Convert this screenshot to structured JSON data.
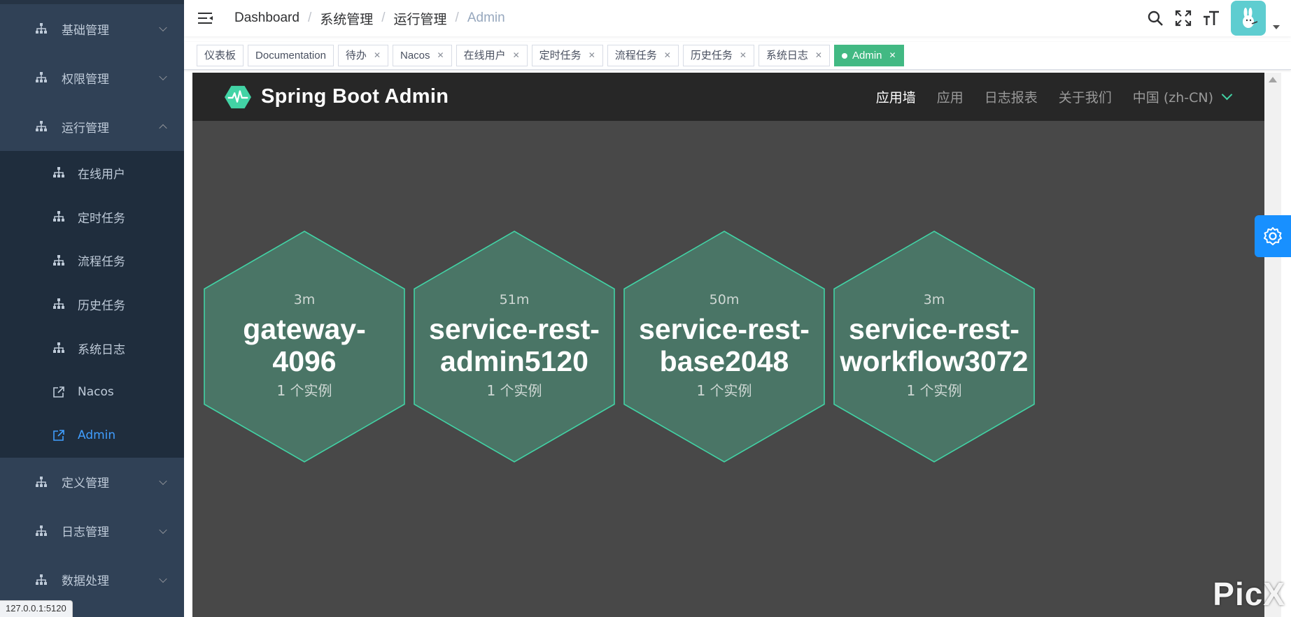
{
  "sidebar": {
    "menus_top": [
      {
        "label": "基础管理",
        "expanded": false
      },
      {
        "label": "权限管理",
        "expanded": false
      },
      {
        "label": "运行管理",
        "expanded": true
      }
    ],
    "submenu": [
      {
        "label": "在线用户",
        "icon": "tree-icon",
        "active": false
      },
      {
        "label": "定时任务",
        "icon": "tree-icon",
        "active": false
      },
      {
        "label": "流程任务",
        "icon": "tree-icon",
        "active": false
      },
      {
        "label": "历史任务",
        "icon": "tree-icon",
        "active": false
      },
      {
        "label": "系统日志",
        "icon": "tree-icon",
        "active": false
      },
      {
        "label": "Nacos",
        "icon": "external-link-icon",
        "active": false
      },
      {
        "label": "Admin",
        "icon": "external-link-icon",
        "active": true
      }
    ],
    "menus_bottom": [
      {
        "label": "定义管理",
        "expanded": false
      },
      {
        "label": "日志管理",
        "expanded": false
      },
      {
        "label": "数据处理",
        "expanded": false
      }
    ]
  },
  "status_url": "127.0.0.1:5120",
  "breadcrumb": [
    "Dashboard",
    "系统管理",
    "运行管理",
    "Admin"
  ],
  "tags": [
    {
      "label": "仪表板",
      "closable": false,
      "active": false
    },
    {
      "label": "Documentation",
      "closable": false,
      "active": false
    },
    {
      "label": "待办",
      "closable": true,
      "active": false
    },
    {
      "label": "Nacos",
      "closable": true,
      "active": false
    },
    {
      "label": "在线用户",
      "closable": true,
      "active": false
    },
    {
      "label": "定时任务",
      "closable": true,
      "active": false
    },
    {
      "label": "流程任务",
      "closable": true,
      "active": false
    },
    {
      "label": "历史任务",
      "closable": true,
      "active": false
    },
    {
      "label": "系统日志",
      "closable": true,
      "active": false
    },
    {
      "label": "Admin",
      "closable": true,
      "active": true
    }
  ],
  "sba": {
    "brand": "Spring Boot Admin",
    "nav": [
      {
        "label": "应用墙",
        "active": true
      },
      {
        "label": "应用",
        "active": false
      },
      {
        "label": "日志报表",
        "active": false
      },
      {
        "label": "关于我们",
        "active": false
      },
      {
        "label": "中国 (zh-CN)",
        "active": false
      }
    ],
    "apps": [
      {
        "age": "3m",
        "name_lines": [
          "gateway-",
          "4096"
        ],
        "instances": "1 个实例"
      },
      {
        "age": "51m",
        "name_lines": [
          "service-rest-",
          "admin5120"
        ],
        "instances": "1 个实例"
      },
      {
        "age": "50m",
        "name_lines": [
          "service-rest-",
          "base2048"
        ],
        "instances": "1 个实例"
      },
      {
        "age": "3m",
        "name_lines": [
          "service-rest-",
          "workflow3072"
        ],
        "instances": "1 个实例"
      }
    ]
  },
  "watermark": "PicX",
  "colors": {
    "sidebar_bg": "#304156",
    "submenu_bg": "#1f2d3d",
    "active_link": "#409eff",
    "tag_active": "#42b983",
    "hex_fill": "#4a7566",
    "hex_stroke": "#42d3a5",
    "sba_nav_bg": "#272727",
    "content_bg": "#484848",
    "gear_button": "#1890ff"
  }
}
